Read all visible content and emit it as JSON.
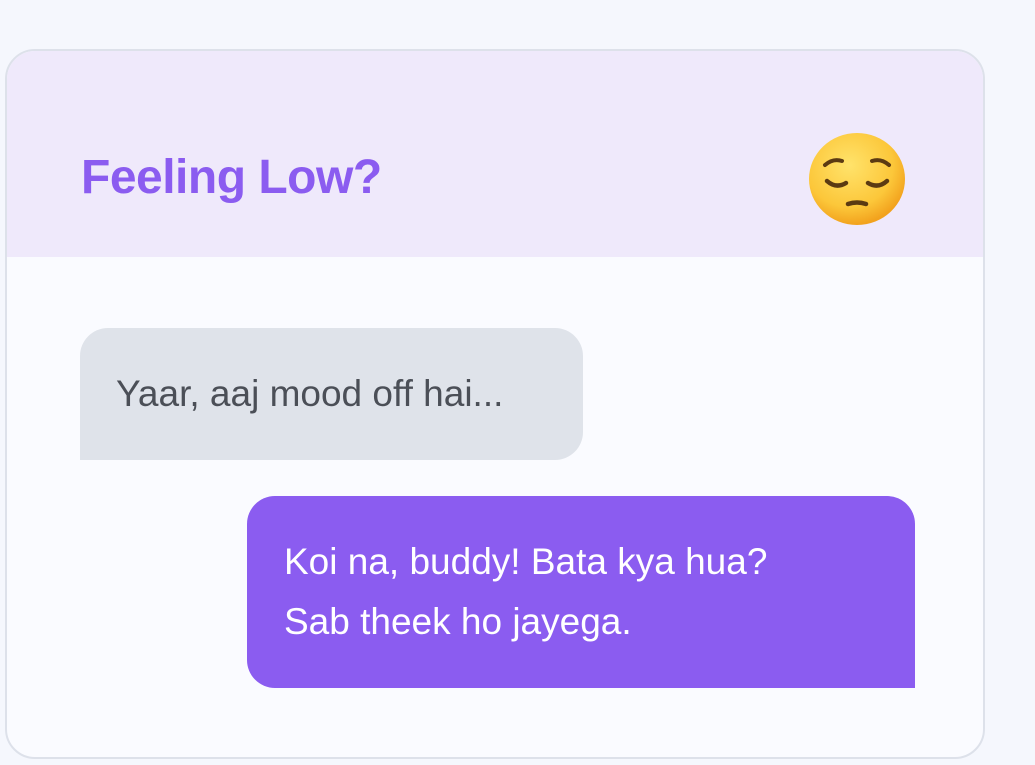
{
  "card": {
    "title": "Feeling Low?",
    "icon": "pensive-face-icon",
    "accent_color": "#8b5cf0",
    "header_bg": "#efe9fb"
  },
  "messages": [
    {
      "sender": "friend",
      "text": "Yaar, aaj mood off hai..."
    },
    {
      "sender": "me",
      "lines": [
        "Koi na, buddy! Bata kya hua?",
        "Sab theek ho jayega."
      ]
    }
  ]
}
